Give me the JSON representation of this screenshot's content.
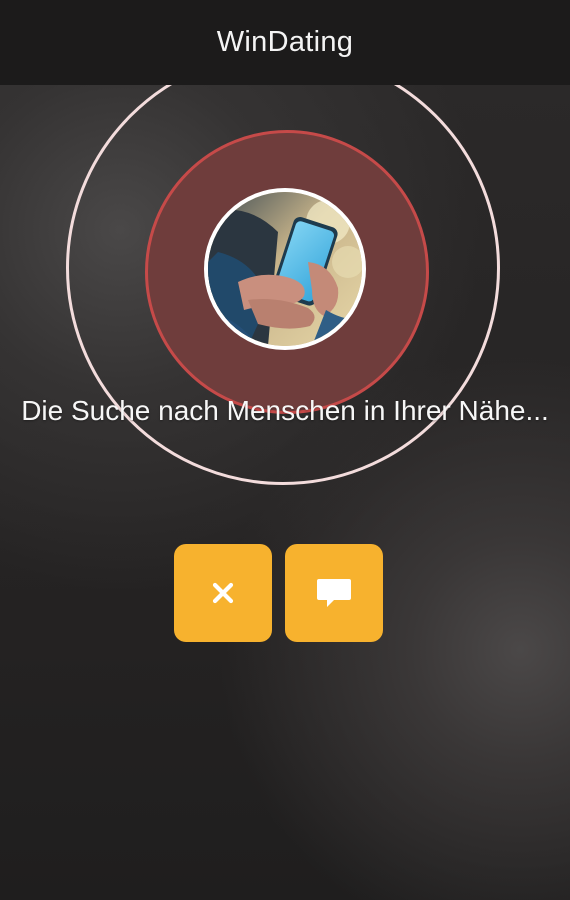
{
  "header": {
    "title": "WinDating"
  },
  "search": {
    "status_text": "Die Suche nach Menschen in Ihrer Nähe..."
  },
  "avatar": {
    "image": "person holding a smartphone"
  },
  "actions": [
    {
      "icon": "close-icon"
    },
    {
      "icon": "chat-icon"
    }
  ],
  "colors": {
    "header_bg": "#1c1b1b",
    "background": "#272525",
    "outer_ring": "#f3dcdc",
    "inner_ring_border": "#c64a49",
    "inner_ring_fill": "#6f3d3c",
    "button_bg": "#f7b22e",
    "text": "#f7f7f7"
  }
}
